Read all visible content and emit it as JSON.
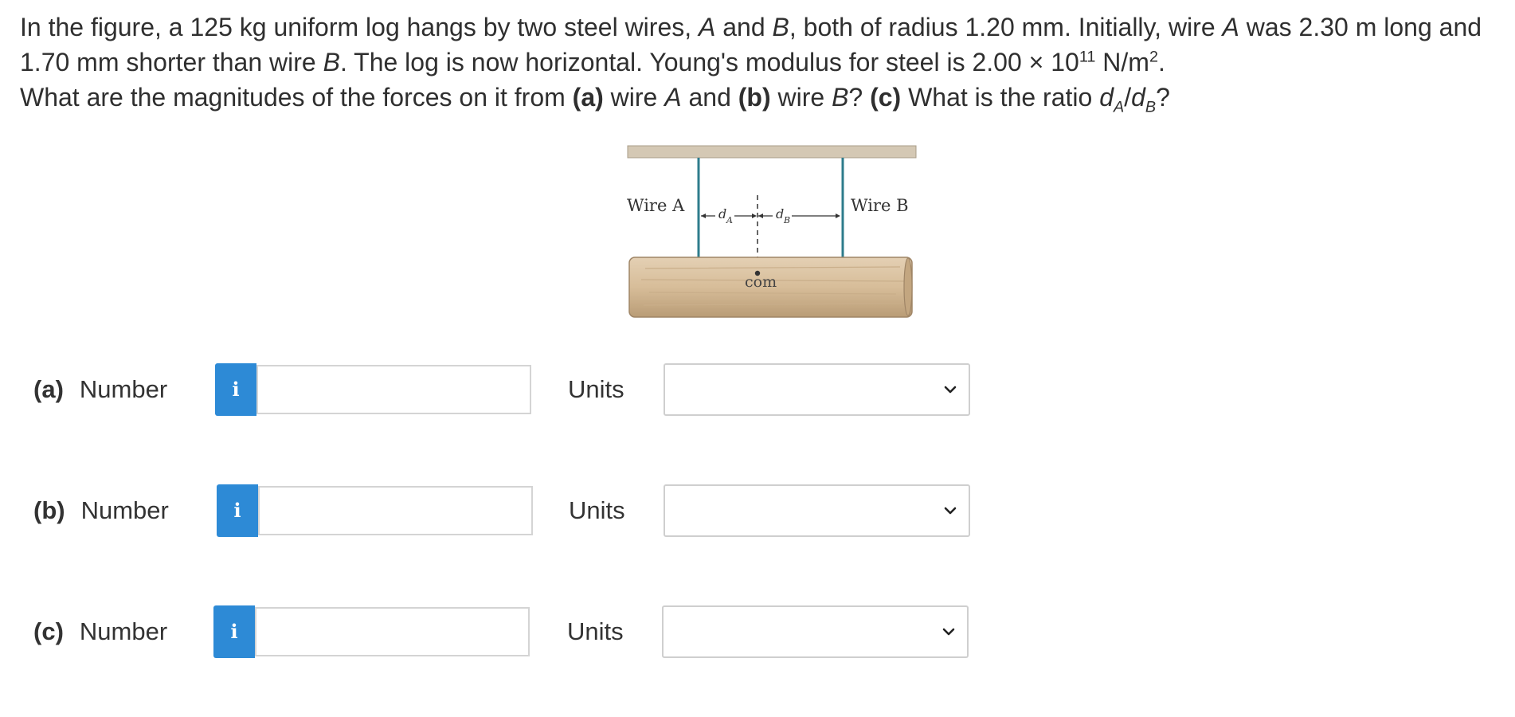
{
  "question": {
    "line1_a": "In the figure, a 125 kg uniform log hangs by two steel wires, ",
    "wire_a_var": "A",
    "line1_b": " and ",
    "wire_b_var": "B",
    "line1_c": ", both of radius 1.20 mm. Initially, wire ",
    "line1_d": " was 2.30 m long and 1.70 mm shorter than wire ",
    "line1_e": ". The log is now horizontal. Young's modulus for steel is 2.00 × 10",
    "exp11": "11",
    "unit_nm": " N/m",
    "exp2": "2",
    "end_dot": ".",
    "line2_a": "What are the magnitudes of the forces on it from ",
    "part_a": "(a)",
    "line2_b": " wire ",
    "line2_c": " and ",
    "part_b": "(b)",
    "line2_d": " wire ",
    "line2_e": "? ",
    "part_c": "(c)",
    "line2_f": " What is the ratio ",
    "d_var": "d",
    "sub_a": "A",
    "slash": "/",
    "sub_b": "B",
    "qmark": "?"
  },
  "figure": {
    "wire_a_label": "Wire A",
    "wire_b_label": "Wire B",
    "d_a": "d",
    "d_a_sub": "A",
    "d_b": "d",
    "d_b_sub": "B",
    "com_label": "com"
  },
  "answers": [
    {
      "part": "(a)",
      "label": "Number",
      "info_icon": "i",
      "value": "",
      "units_label": "Units",
      "units_selected": ""
    },
    {
      "part": "(b)",
      "label": "Number",
      "info_icon": "i",
      "value": "",
      "units_label": "Units",
      "units_selected": ""
    },
    {
      "part": "(c)",
      "label": "Number",
      "info_icon": "i",
      "value": "",
      "units_label": "Units",
      "units_selected": ""
    }
  ],
  "colors": {
    "info_button": "#2d8ad6",
    "wire": "#2e7c8c",
    "log": "#d4b896",
    "ceiling": "#cfc3b0"
  }
}
